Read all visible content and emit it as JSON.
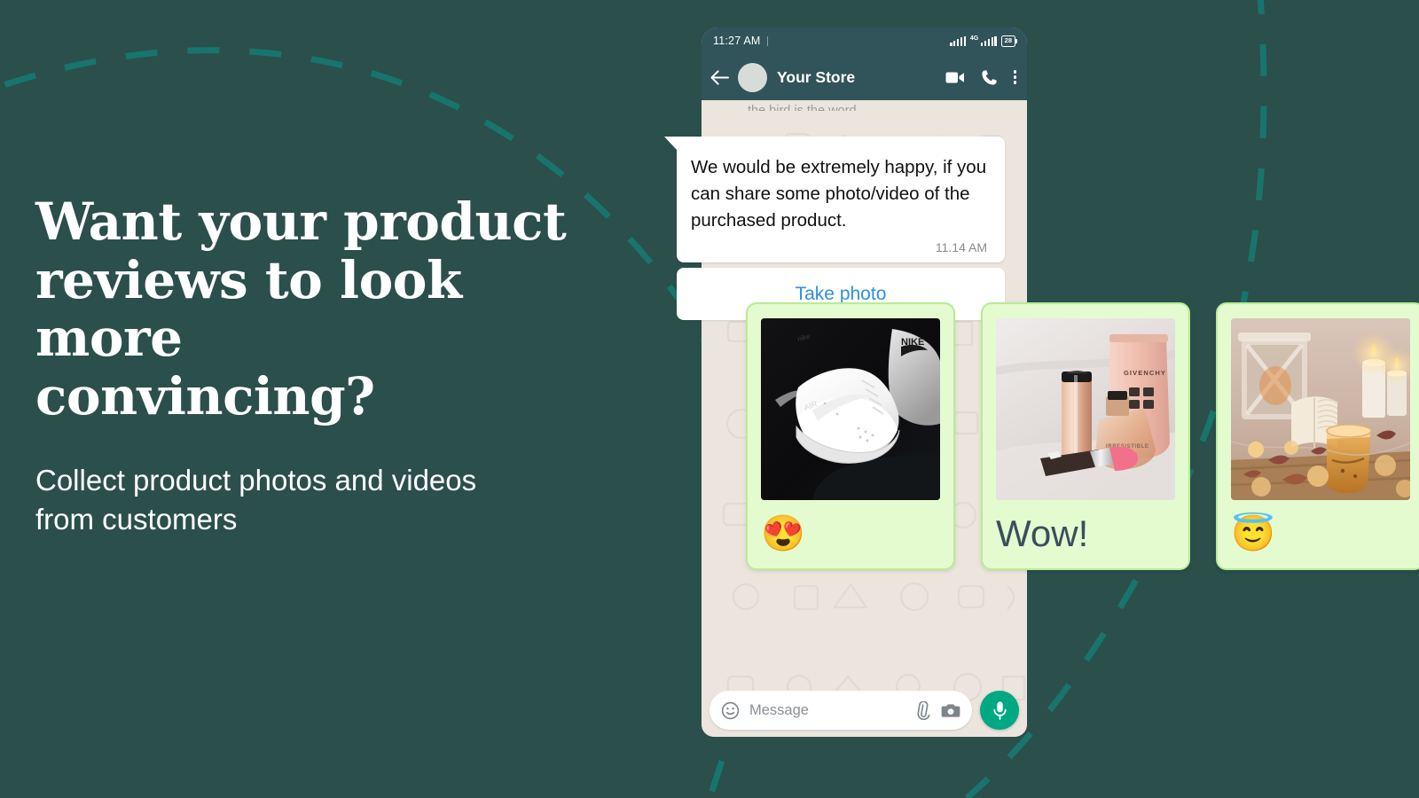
{
  "theme": {
    "background": "#2b4f4b",
    "dash_color": "#17756e",
    "card_bg": "#e4fbcf",
    "card_border": "#b9eb95",
    "accent_blue": "#2f8fe0",
    "whatsapp_green": "#00a884",
    "header_bg": "#31535a",
    "chat_bg": "#ece5dd"
  },
  "hero": {
    "title_line1": "Want your product",
    "title_line2": "reviews to look more",
    "title_line3": "convincing?",
    "subtitle_line1": "Collect product photos and videos",
    "subtitle_line2": "from customers"
  },
  "phone": {
    "status_bar": {
      "time": "11:27 AM",
      "network_label": "4G",
      "battery_level": "28",
      "signal_icon": "signal-bars-icon",
      "battery_icon": "battery-icon"
    },
    "header": {
      "back_icon": "back-arrow-icon",
      "avatar_icon": "avatar",
      "contact_name": "Your Store",
      "video_icon": "video-call-icon",
      "call_icon": "phone-call-icon",
      "menu_icon": "kebab-menu-icon"
    },
    "chat": {
      "clipped_message": "the bird is the word",
      "bubble": {
        "text": "We would be extremely happy, if you can share some photo/video of the purchased product.",
        "time": "11.14 AM"
      },
      "take_photo_label": "Take photo"
    },
    "input_bar": {
      "emoji_icon": "emoji-smiley-icon",
      "placeholder": "Message",
      "attach_icon": "paperclip-icon",
      "camera_icon": "camera-icon",
      "mic_icon": "microphone-icon"
    }
  },
  "review_cards": [
    {
      "photo_name": "nike-air-force-sneaker-photo",
      "photo_alt": "White Nike Air Force sneaker on black background",
      "caption": "😍",
      "caption_type": "emoji"
    },
    {
      "photo_name": "givenchy-cosmetics-photo",
      "photo_alt": "Givenchy lipstick, perfume and cream on white fabric",
      "caption": "Wow!",
      "caption_type": "text"
    },
    {
      "photo_name": "cozy-autumn-candles-photo",
      "photo_alt": "Cozy autumn scene with lantern, candles, book and tea",
      "caption": "😇",
      "caption_type": "emoji"
    }
  ]
}
